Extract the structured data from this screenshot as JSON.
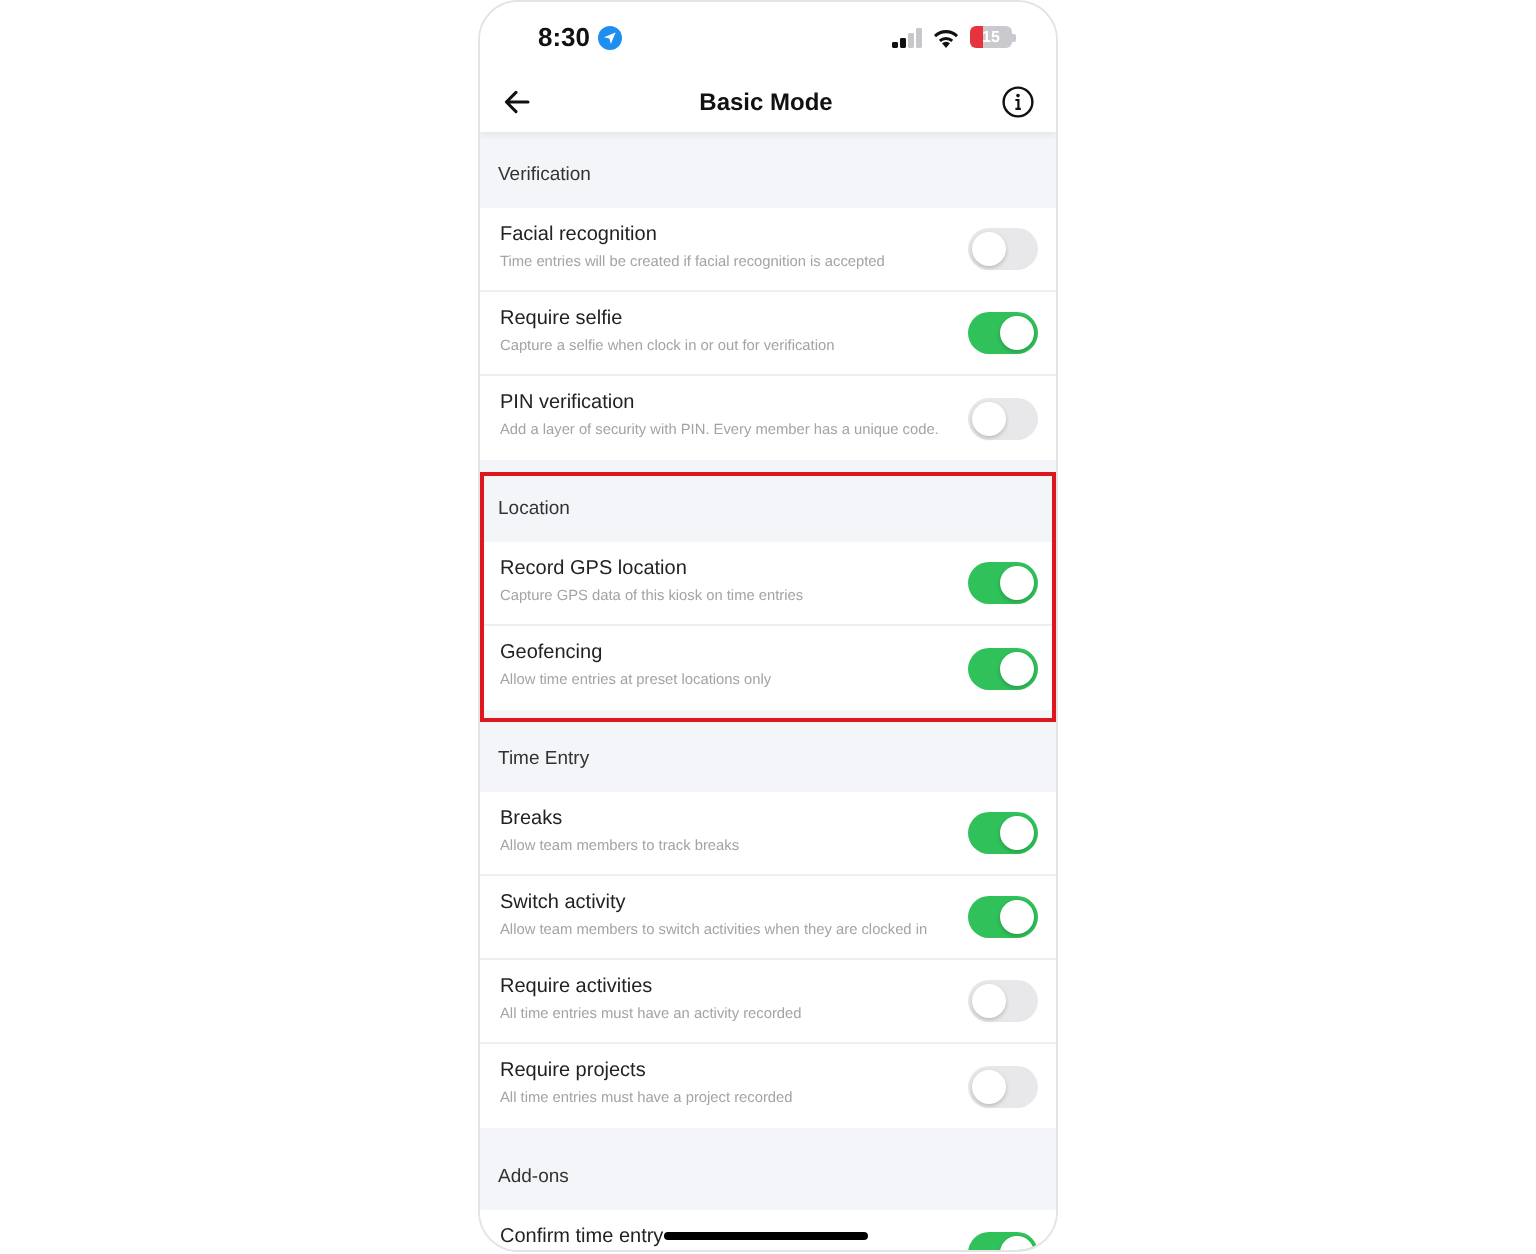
{
  "status_bar": {
    "time": "8:30",
    "battery": "15"
  },
  "nav_bar": {
    "title": "Basic Mode"
  },
  "sections": [
    {
      "title": "Verification",
      "highlighted": false,
      "settings": [
        {
          "title": "Facial recognition",
          "description": "Time entries will be created if facial recognition is accepted",
          "on": false
        },
        {
          "title": "Require selfie",
          "description": "Capture a selfie when clock in or out for verification",
          "on": true
        },
        {
          "title": "PIN verification",
          "description": "Add a layer of security with PIN. Every member has a unique code.",
          "on": false
        }
      ]
    },
    {
      "title": "Location",
      "highlighted": true,
      "settings": [
        {
          "title": "Record GPS location",
          "description": "Capture GPS data of this kiosk on time entries",
          "on": true
        },
        {
          "title": "Geofencing",
          "description": "Allow time entries at preset locations only",
          "on": true
        }
      ]
    },
    {
      "title": "Time Entry",
      "highlighted": false,
      "settings": [
        {
          "title": "Breaks",
          "description": "Allow team members to track breaks",
          "on": true
        },
        {
          "title": "Switch activity",
          "description": "Allow team members to switch activities when they are clocked in",
          "on": true
        },
        {
          "title": "Require activities",
          "description": "All time entries must have an activity recorded",
          "on": false
        },
        {
          "title": "Require projects",
          "description": "All time entries must have a project recorded",
          "on": false
        }
      ]
    },
    {
      "title": "Add-ons",
      "highlighted": false,
      "settings": [
        {
          "title": "Confirm time entry",
          "on": true
        }
      ]
    }
  ]
}
